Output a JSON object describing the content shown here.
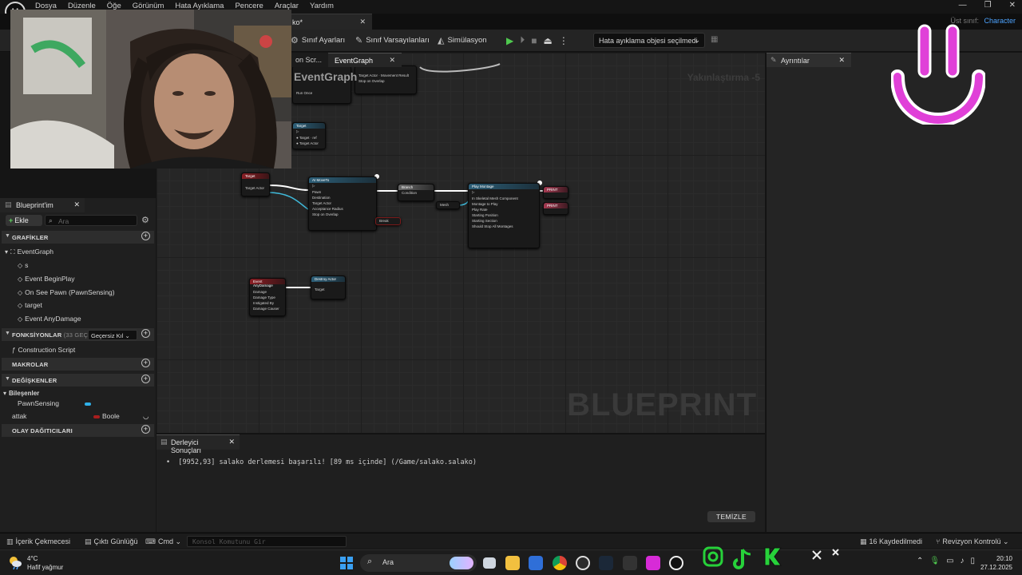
{
  "app": {
    "menu": [
      "Dosya",
      "Düzenle",
      "Öğe",
      "Görünüm",
      "Hata Ayıklama",
      "Pencere",
      "Araçlar",
      "Yardım"
    ],
    "doc_tab": "ko*",
    "parent_class_label": "Üst sınıf:",
    "parent_class_value": "Character"
  },
  "toolbar": {
    "class_settings": "Sınıf Ayarları",
    "class_defaults": "Sınıf Varsayılanları",
    "simulation": "Simülasyon",
    "debug_select": "Hata ayıklama objesi seçilmedi"
  },
  "graph": {
    "tab_prev": "on Scr...",
    "tab_active": "EventGraph",
    "zoom_label": "Yakınlaştırma -5",
    "title": "EventGraph",
    "watermark": "BLUEPRINT",
    "nodes": [
      {
        "title": "Target",
        "rows": [
          "Target Actor"
        ]
      },
      {
        "title": "AI MoveTo",
        "rows": [
          "Pawn",
          "Destination",
          "Target Actor",
          "Acceptance Radius",
          "Stop on Overlap",
          "On Success",
          "On Fail",
          "Movement Result"
        ]
      },
      {
        "title": "Branch",
        "rows": [
          "Condition",
          "True",
          "False"
        ]
      },
      {
        "title": "Play Montage",
        "rows": [
          "In Skeletal Mesh Component",
          "Montage to Play",
          "Play Rate",
          "Starting Position",
          "Starting Section",
          "Should Stop All Montages",
          "On Completed",
          "On Blend Out",
          "On Interrupted",
          "On Notify Begin",
          "On Notify End",
          "Notify Name"
        ]
      },
      {
        "title": "Event AnyDamage",
        "rows": [
          "Damage",
          "Damage Type",
          "Instigated By",
          "Damage Causer"
        ]
      },
      {
        "title": "Destroy Actor",
        "rows": [
          "Target"
        ]
      }
    ]
  },
  "details": {
    "tab": "Ayrıntılar"
  },
  "my_blueprint": {
    "tab": "Blueprint'im",
    "add_button": "Ekle",
    "search_placeholder": "Ara",
    "sections": {
      "graphs": "GRAFİKLER",
      "functions": "FONKSİYONLAR",
      "functions_count": "(33 GEÇERS",
      "functions_filter": "Geçersiz Kıl",
      "macros": "MAKROLAR",
      "variables": "DEĞİŞKENLER",
      "dispatchers": "OLAY DAĞITICILARI"
    },
    "graphs": {
      "root": "EventGraph",
      "children": [
        "s",
        "Event BeginPlay",
        "On See Pawn (PawnSensing)",
        "target",
        "Event AnyDamage"
      ]
    },
    "functions": [
      "Construction Script"
    ],
    "components_header": "Bileşenler",
    "component_item": "PawnSensing",
    "variable": {
      "name": "attak",
      "type": "Boole"
    }
  },
  "compiler": {
    "tab": "Derleyici Sonuçları",
    "message": "[9952,93] salako derlemesi başarılı! [89 ms içinde] (/Game/salako.salako)",
    "clear_button": "TEMİZLE"
  },
  "statusbar": {
    "content_drawer": "İçerik Çekmecesi",
    "output_log": "Çıktı Günlüğü",
    "cmd": "Cmd",
    "console_placeholder": "Konsol Komutunu Gir",
    "unsaved": "16 Kaydedilmedi",
    "revision": "Revizyon Kontrolü"
  },
  "taskbar": {
    "temperature": "4°C",
    "weather": "Hafif yağmur",
    "search": "Ara",
    "time": "20:10",
    "date": "27.12.2025"
  },
  "colors": {
    "accent_blue": "#4da3ff",
    "smiley_pink": "#e040d8",
    "exec_white": "#ffffff",
    "data_cyan": "#3fb8d8"
  }
}
